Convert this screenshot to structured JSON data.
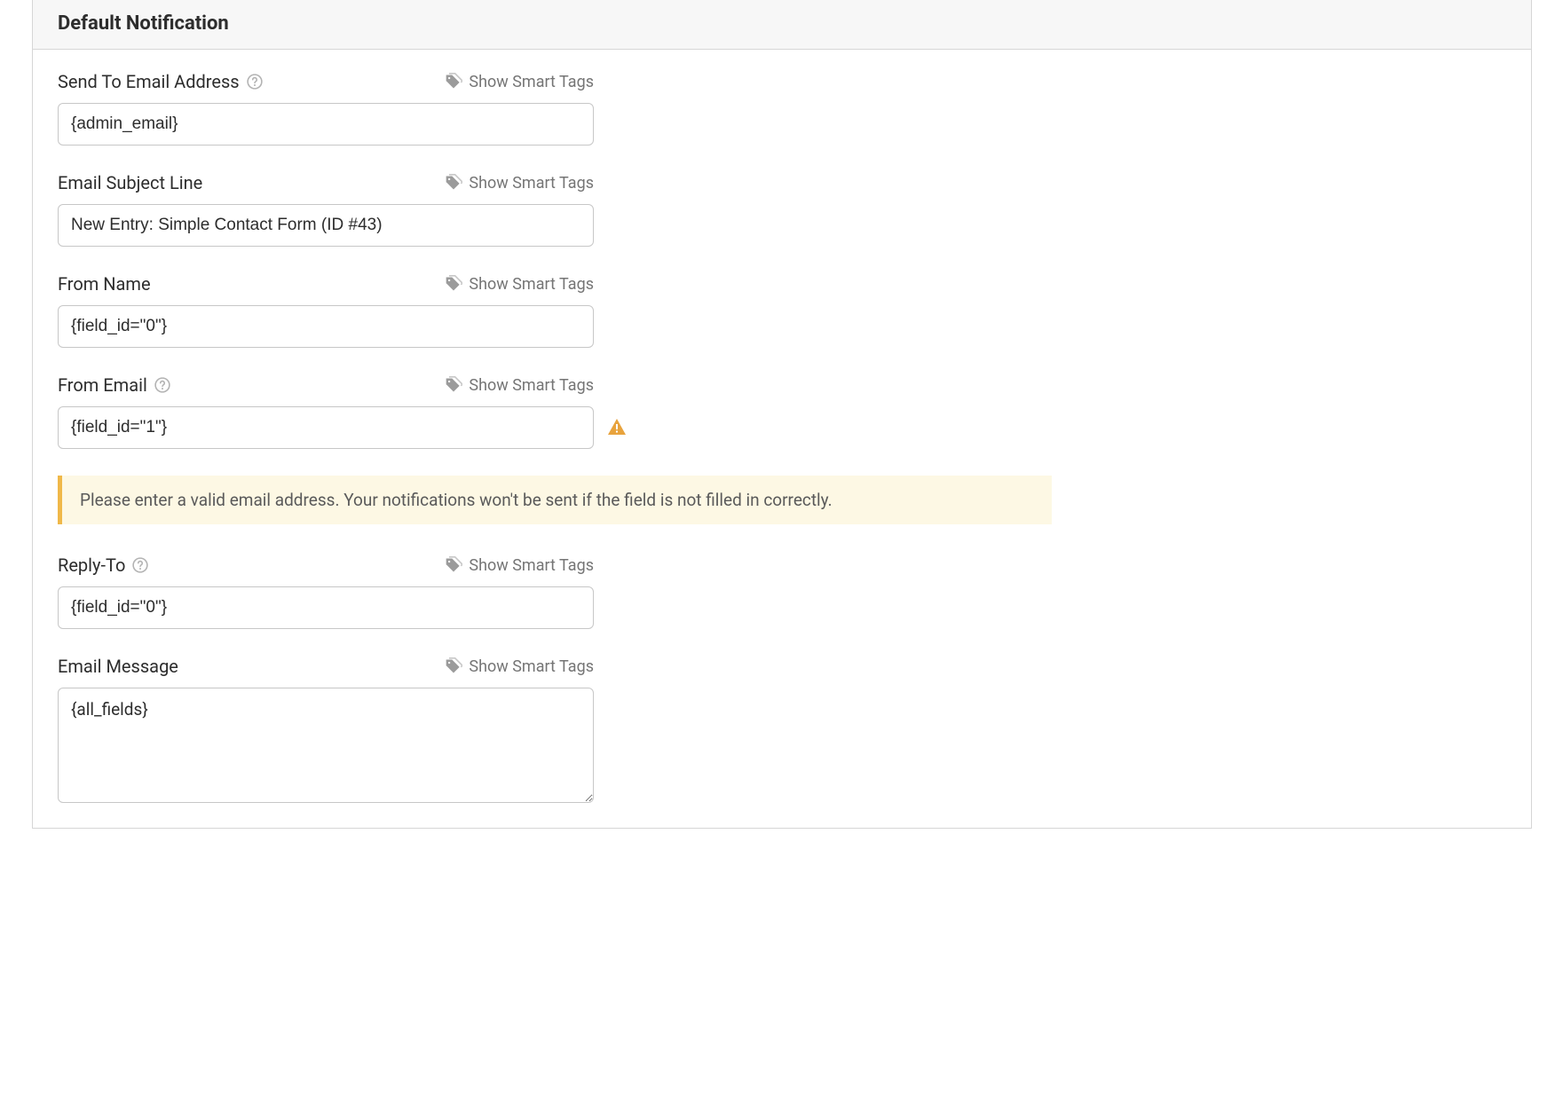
{
  "panel": {
    "title": "Default Notification"
  },
  "smartTagsLabel": "Show Smart Tags",
  "fields": {
    "sendTo": {
      "label": "Send To Email Address",
      "value": "{admin_email}"
    },
    "subject": {
      "label": "Email Subject Line",
      "value": "New Entry: Simple Contact Form (ID #43)"
    },
    "fromName": {
      "label": "From Name",
      "value": "{field_id=\"0\"}"
    },
    "fromEmail": {
      "label": "From Email",
      "value": "{field_id=\"1\"}"
    },
    "replyTo": {
      "label": "Reply-To",
      "value": "{field_id=\"0\"}"
    },
    "message": {
      "label": "Email Message",
      "value": "{all_fields}"
    }
  },
  "notice": "Please enter a valid email address. Your notifications won't be sent if the field is not filled in correctly."
}
